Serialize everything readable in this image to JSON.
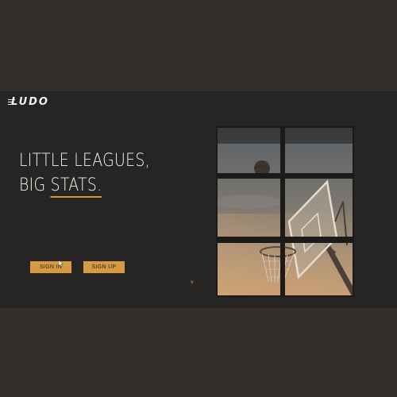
{
  "brand": {
    "logo_text": "LUDO"
  },
  "hero": {
    "headline_line1": "LITTLE LEAGUES,",
    "headline_line2_prefix": "BIG ",
    "headline_line2_emphasis": "STATS."
  },
  "actions": {
    "sign_in_label": "SIGN IN",
    "sign_up_label": "SIGN UP"
  },
  "scroll": {
    "icon": "double-chevron-down-icon",
    "glyph": "«"
  },
  "image": {
    "subject": "basketball-hoop-photo"
  },
  "colors": {
    "background": "#322f2d",
    "hero_background": "#272523",
    "accent": "#d49b42",
    "text": "#f4f2ee"
  }
}
